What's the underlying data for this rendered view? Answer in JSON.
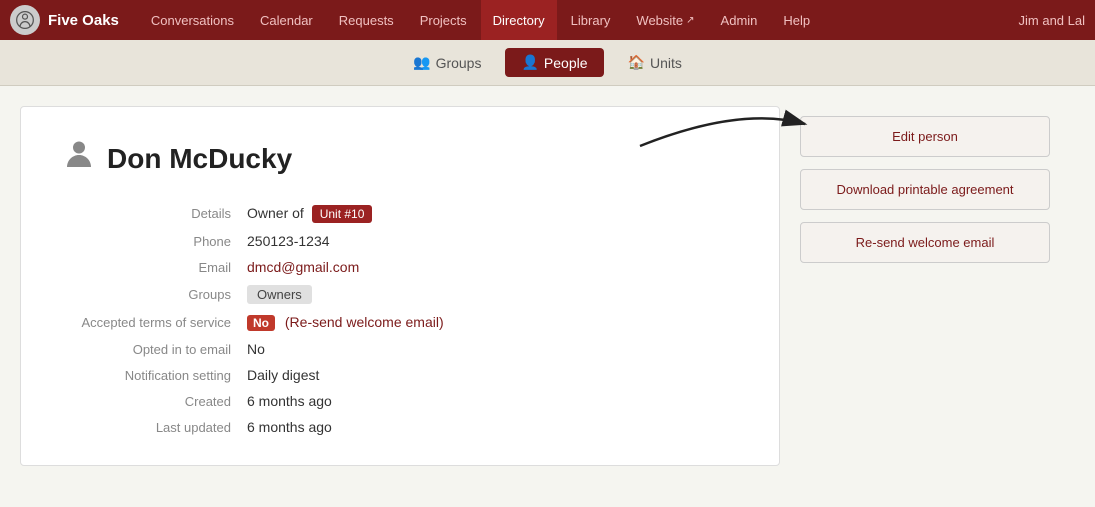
{
  "site": {
    "logo_text": "Five Oaks",
    "logo_icon": "⊙"
  },
  "top_nav": {
    "items": [
      {
        "label": "Conversations",
        "active": false
      },
      {
        "label": "Calendar",
        "active": false
      },
      {
        "label": "Requests",
        "active": false
      },
      {
        "label": "Projects",
        "active": false
      },
      {
        "label": "Directory",
        "active": true
      },
      {
        "label": "Library",
        "active": false
      },
      {
        "label": "Website ↗",
        "active": false
      },
      {
        "label": "Admin",
        "active": false
      },
      {
        "label": "Help",
        "active": false
      }
    ],
    "user_label": "Jim and Lal"
  },
  "sub_nav": {
    "items": [
      {
        "label": "Groups",
        "icon": "👥",
        "active": false
      },
      {
        "label": "People",
        "icon": "👤",
        "active": true
      },
      {
        "label": "Units",
        "icon": "🏠",
        "active": false
      }
    ]
  },
  "person": {
    "name": "Don McDucky",
    "details_label": "Details",
    "details_text": "Owner of",
    "unit_label": "Unit #10",
    "phone_label": "Phone",
    "phone_value": "250123-1234",
    "email_label": "Email",
    "email_value": "dmcd@gmail.com",
    "groups_label": "Groups",
    "groups_value": "Owners",
    "tos_label": "Accepted terms of service",
    "tos_badge": "No",
    "tos_link": "(Re-send welcome email)",
    "opted_label": "Opted in to email",
    "opted_value": "No",
    "notification_label": "Notification setting",
    "notification_value": "Daily digest",
    "created_label": "Created",
    "created_value": "6 months ago",
    "updated_label": "Last updated",
    "updated_value": "6 months ago"
  },
  "actions": {
    "edit_label": "Edit person",
    "download_label": "Download printable agreement",
    "resend_label": "Re-send welcome email"
  },
  "colors": {
    "nav_bg": "#7b1a1a",
    "active_nav": "#9b2222",
    "unit_badge": "#9b2222",
    "action_text": "#7b1a1a"
  }
}
